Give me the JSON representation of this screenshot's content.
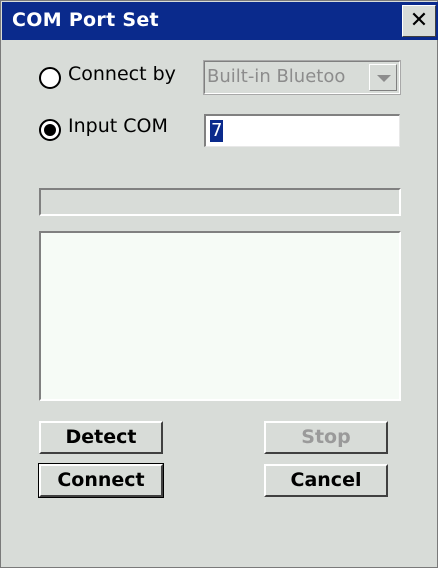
{
  "window": {
    "title": "COM Port Set",
    "close_label": "✕"
  },
  "options": {
    "connect_by": {
      "label": "Connect by",
      "selected": false
    },
    "input_com": {
      "label": "Input COM",
      "selected": true
    }
  },
  "connect_method": {
    "value": "Built-in Bluetooth",
    "display": "Built-in Bluetoo",
    "enabled": false
  },
  "com_port": {
    "value": "7"
  },
  "progress": {
    "value": 0
  },
  "log": {
    "text": ""
  },
  "buttons": {
    "detect": "Detect",
    "stop": "Stop",
    "connect": "Connect",
    "cancel": "Cancel"
  }
}
